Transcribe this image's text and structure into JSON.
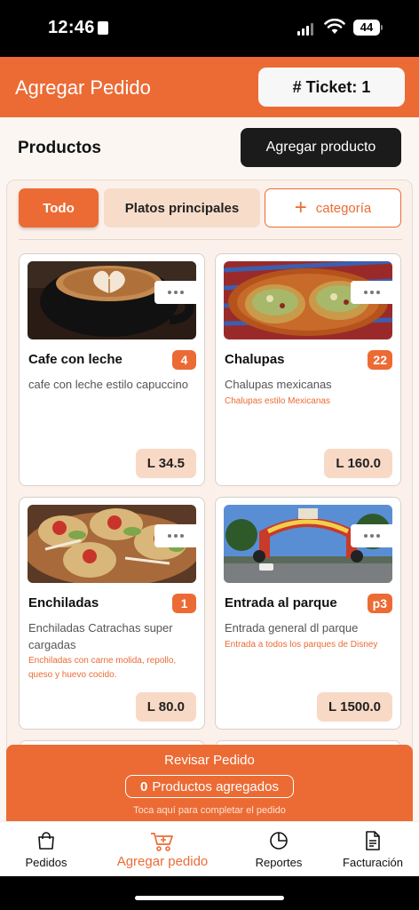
{
  "status_bar": {
    "time": "12:46",
    "battery": "44"
  },
  "header": {
    "title": "Agregar Pedido",
    "ticket_label": "# Ticket: 1"
  },
  "products": {
    "title": "Productos",
    "add_button": "Agregar producto",
    "categories": [
      {
        "label": "Todo",
        "selected": true
      },
      {
        "label": "Platos principales",
        "selected": false
      }
    ],
    "add_category_label": "categoría",
    "items": [
      {
        "name": "Cafe con leche",
        "badge": "4",
        "description": "cafe con leche estilo capuccino",
        "detail": "",
        "price": "L 34.5",
        "image": "coffee"
      },
      {
        "name": "Chalupas",
        "badge": "22",
        "description": "Chalupas mexicanas",
        "detail": "Chalupas estilo Mexicanas",
        "price": "L 160.0",
        "image": "chalupas"
      },
      {
        "name": "Enchiladas",
        "badge": "1",
        "description": "Enchiladas Catrachas super cargadas",
        "detail": "Enchiladas con carne molida, repollo, queso y huevo cocido.",
        "price": "L 80.0",
        "image": "enchiladas"
      },
      {
        "name": "Entrada al parque",
        "badge": "p3",
        "description": "Entrada general dl parque",
        "detail": "Entrada a todos los parques de Disney",
        "price": "L 1500.0",
        "image": "park-entrance"
      }
    ]
  },
  "review": {
    "title": "Revisar Pedido",
    "count": "0",
    "count_label": "Productos agregados",
    "hint": "Toca aquí para completar el pedido"
  },
  "tabs": [
    {
      "label": "Pedidos",
      "icon": "shopping-bag-icon",
      "active": false
    },
    {
      "label": "Agregar pedido",
      "icon": "cart-add-icon",
      "active": true
    },
    {
      "label": "Reportes",
      "icon": "pie-chart-icon",
      "active": false
    },
    {
      "label": "Facturación",
      "icon": "document-icon",
      "active": false
    }
  ],
  "colors": {
    "accent": "#ec6b34",
    "accent_light": "#f8d9c6",
    "dark_button": "#1b1b1b",
    "background": "#fcf6f2"
  }
}
